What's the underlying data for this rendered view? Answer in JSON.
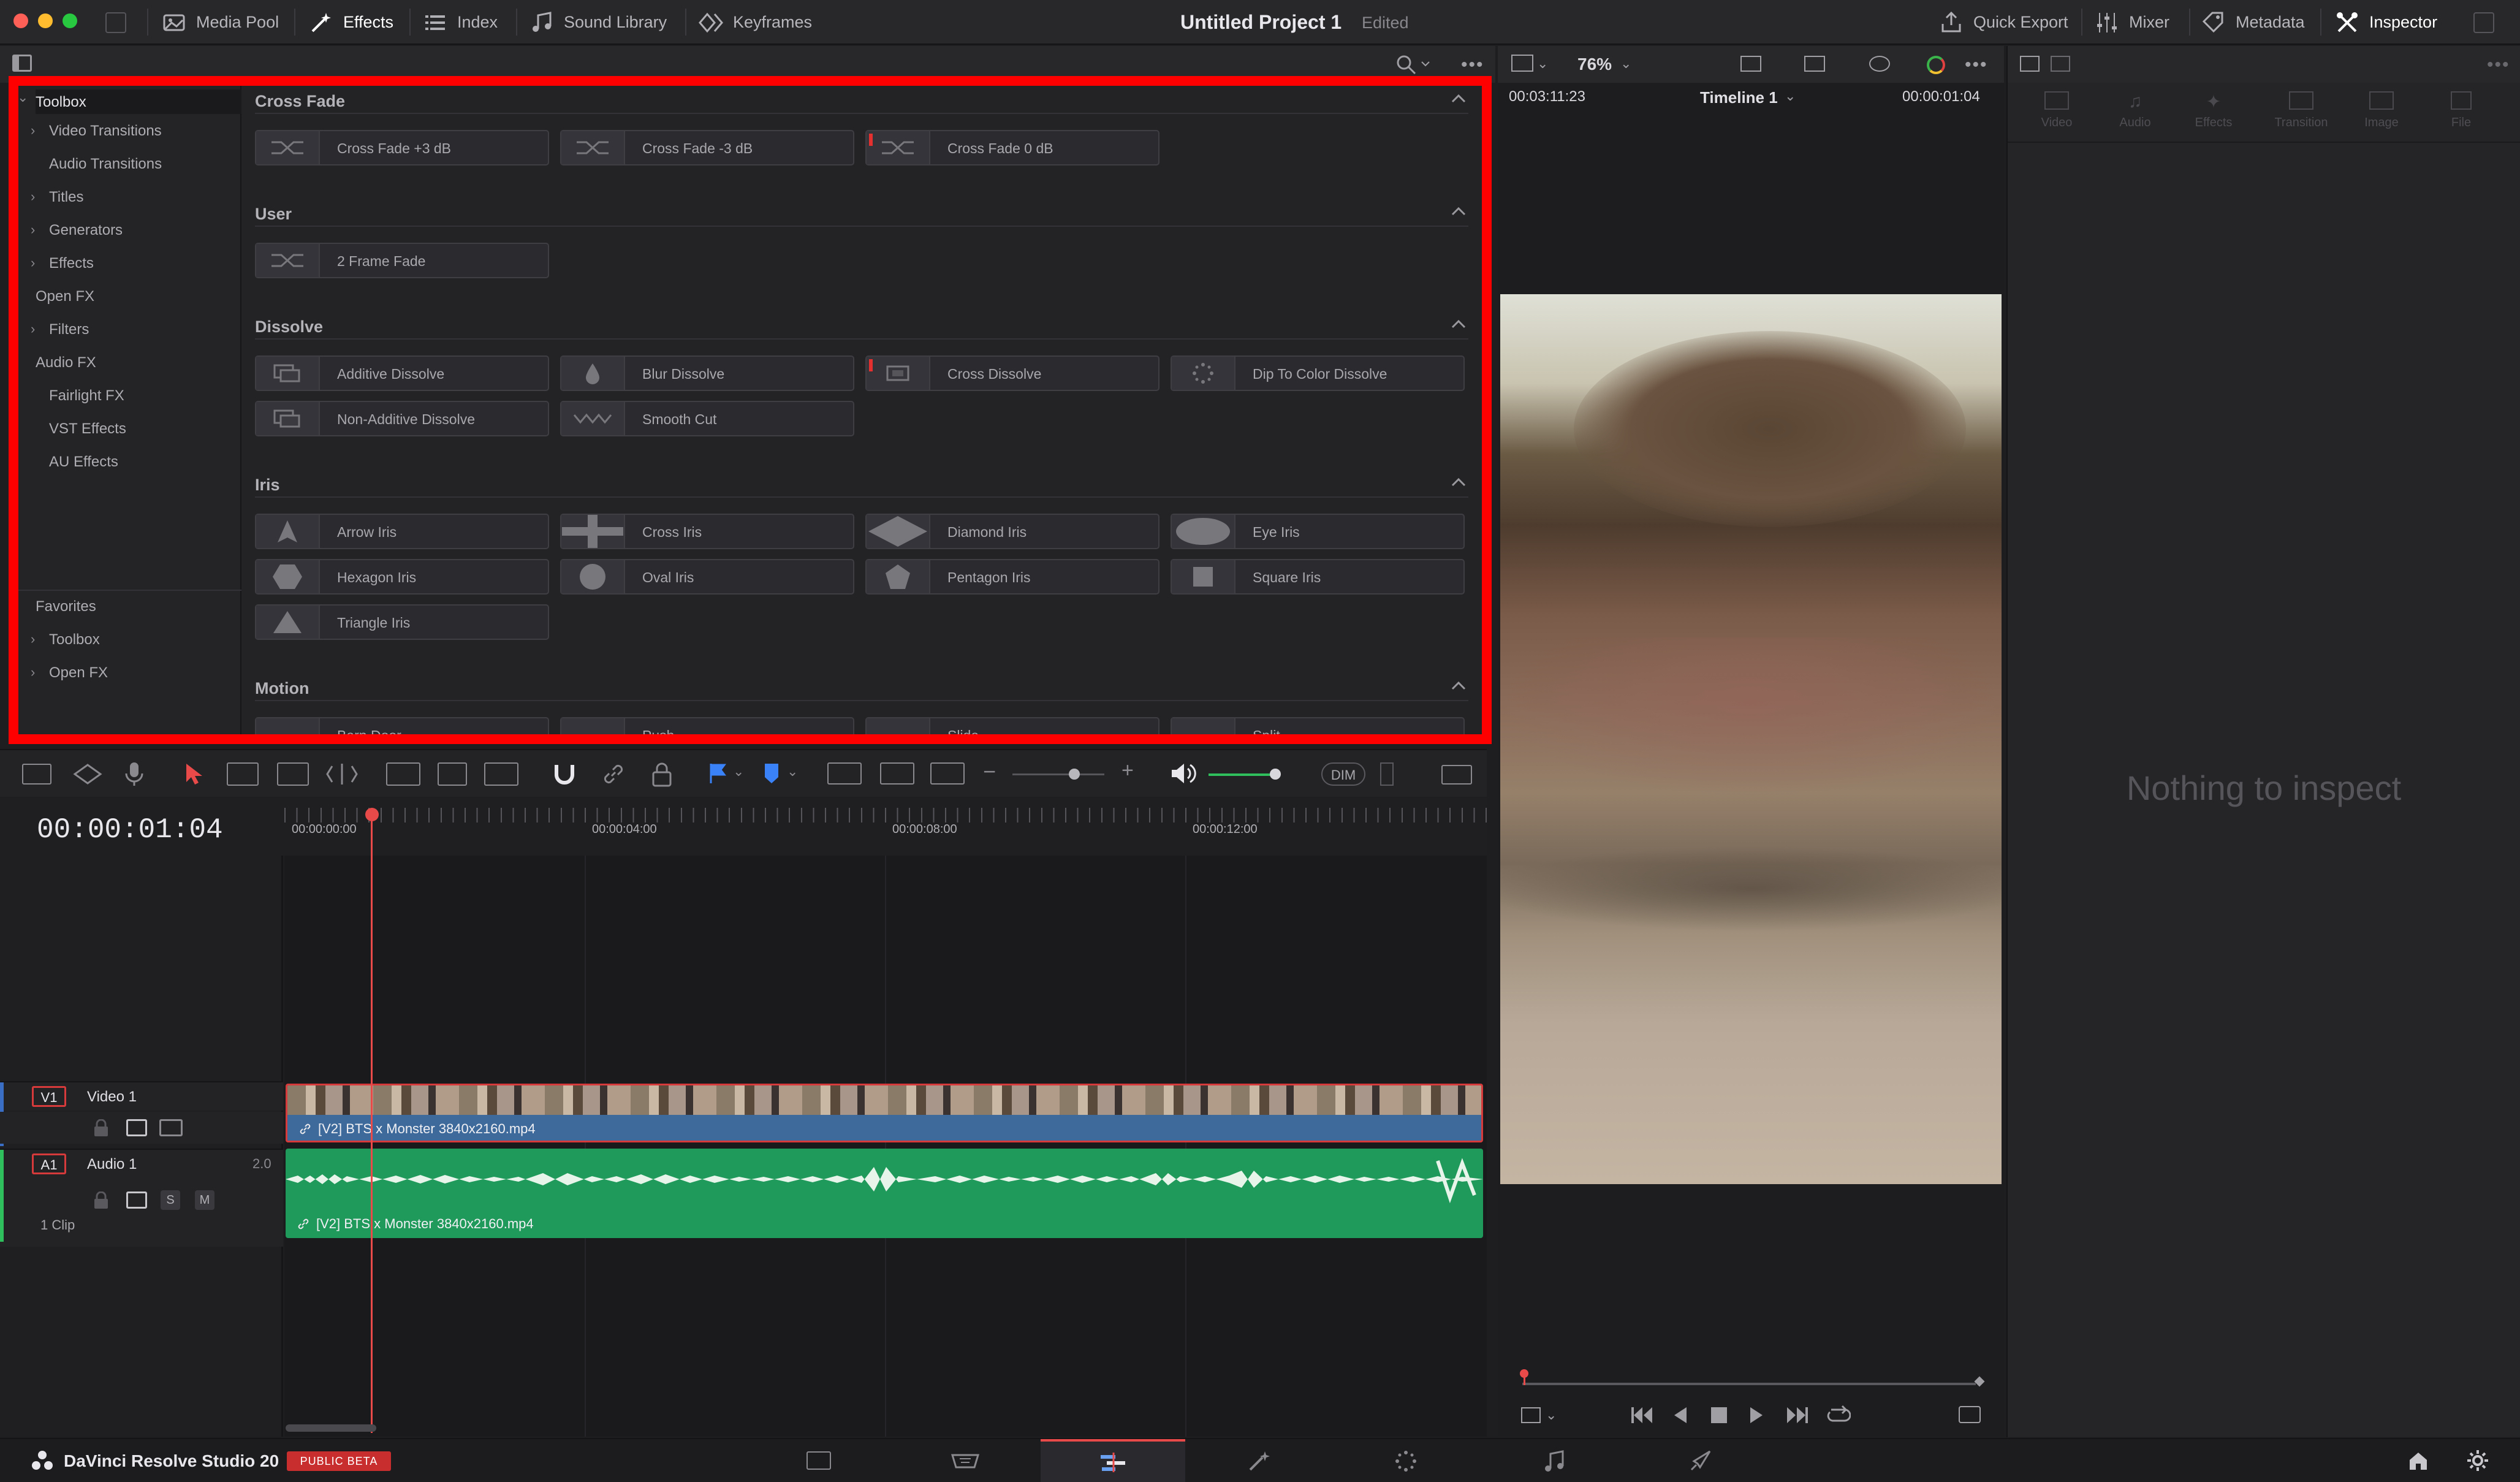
{
  "topbar": {
    "media_pool": "Media Pool",
    "effects": "Effects",
    "index": "Index",
    "sound_library": "Sound Library",
    "keyframes": "Keyframes",
    "project_title": "Untitled Project 1",
    "project_status": "Edited",
    "quick_export": "Quick Export",
    "mixer": "Mixer",
    "metadata": "Metadata",
    "inspector": "Inspector"
  },
  "viewer": {
    "zoom": "76%",
    "source_timecode": "00:03:11:23",
    "timeline_name": "Timeline 1",
    "record_timecode": "00:00:01:04"
  },
  "effects_tree": {
    "toolbox": "Toolbox",
    "items": [
      "Video Transitions",
      "Audio Transitions",
      "Titles",
      "Generators",
      "Effects",
      "Open FX",
      "Filters",
      "Audio FX",
      "Fairlight FX",
      "VST Effects",
      "AU Effects"
    ],
    "favorites": "Favorites",
    "fav_items": [
      "Toolbox",
      "Open FX"
    ]
  },
  "effects_list": {
    "cross_fade": {
      "title": "Cross Fade",
      "items": [
        "Cross Fade +3 dB",
        "Cross Fade -3 dB",
        "Cross Fade 0 dB"
      ]
    },
    "user": {
      "title": "User",
      "items": [
        "2 Frame Fade"
      ]
    },
    "dissolve": {
      "title": "Dissolve",
      "items": [
        "Additive Dissolve",
        "Blur Dissolve",
        "Cross Dissolve",
        "Dip To Color Dissolve",
        "Non-Additive Dissolve",
        "Smooth Cut"
      ]
    },
    "iris": {
      "title": "Iris",
      "items": [
        "Arrow Iris",
        "Cross Iris",
        "Diamond Iris",
        "Eye Iris",
        "Hexagon Iris",
        "Oval Iris",
        "Pentagon Iris",
        "Square Iris",
        "Triangle Iris"
      ]
    },
    "motion": {
      "title": "Motion",
      "items": [
        "Barn Door",
        "Push",
        "Slide",
        "Split"
      ]
    }
  },
  "timeline": {
    "timecode": "00:00:01:04",
    "ruler": [
      "00:00:00:00",
      "00:00:04:00",
      "00:00:08:00",
      "00:00:12:00"
    ],
    "dim": "DIM",
    "video_track": {
      "id": "V1",
      "name": "Video 1",
      "clip": "[V2] BTS x Monster 3840x2160.mp4"
    },
    "audio_track": {
      "id": "A1",
      "name": "Audio 1",
      "level": "2.0",
      "clip": "[V2] BTS x Monster 3840x2160.mp4",
      "clip_count": "1 Clip",
      "solo": "S",
      "mute": "M"
    }
  },
  "inspector": {
    "tabs": [
      "Video",
      "Audio",
      "Effects",
      "Transition",
      "Image",
      "File"
    ],
    "empty": "Nothing to inspect"
  },
  "bottombar": {
    "app_name": "DaVinci Resolve Studio 20",
    "badge": "PUBLIC BETA"
  }
}
